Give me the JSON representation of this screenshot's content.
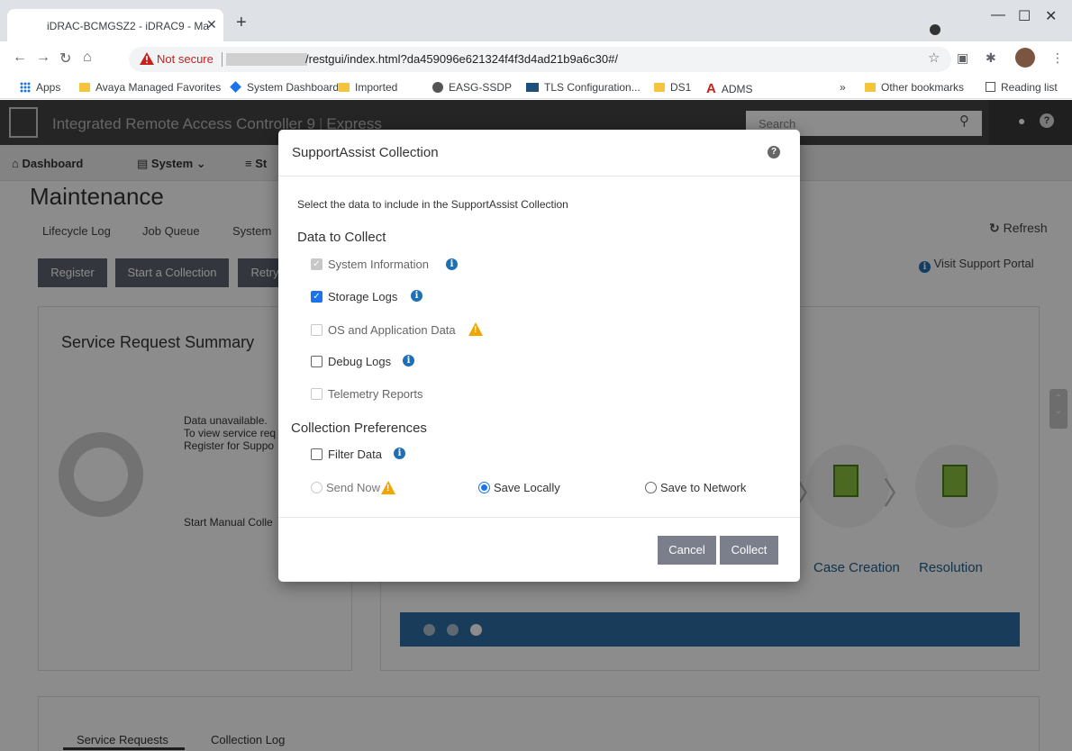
{
  "browser": {
    "tab_title": "iDRAC-BCMGSZ2 - iDRAC9 - Ma",
    "new_tab_label": "+",
    "not_secure": "Not secure",
    "url": "/restgui/index.html?da459096e621324f4f3d4ad21b9a6c30#/",
    "bookmarks": [
      "Apps",
      "Avaya Managed Favorites",
      "System Dashboard...",
      "Imported",
      "EASG-SSDP",
      "TLS Configuration...",
      "DS1",
      "ADMS"
    ],
    "overflow_label": "»",
    "other_bookmarks": "Other bookmarks",
    "reading_list": "Reading list"
  },
  "idrac": {
    "header_title": "Integrated Remote Access Controller 9",
    "header_edition": "Express",
    "search_placeholder": "Search",
    "nav": [
      "Dashboard",
      "System",
      "St"
    ],
    "page_title": "Maintenance",
    "subtabs": [
      "Lifecycle Log",
      "Job Queue",
      "System"
    ],
    "refresh": "Refresh",
    "buttons": [
      "Register",
      "Start a Collection",
      "Retry"
    ],
    "support_portal": "Visit Support Portal",
    "summary_title": "Service Request Summary",
    "data_unavailable": "Data unavailable.",
    "view_service": "To view service req",
    "register_support": "Register for Suppo",
    "start_manual": "Start Manual Colle",
    "process_labels": [
      "Case Creation",
      "Resolution"
    ],
    "bottom_tabs": [
      "Service Requests",
      "Collection Log"
    ]
  },
  "modal": {
    "title": "SupportAssist Collection",
    "intro": "Select the data to include in the SupportAssist Collection",
    "data_heading": "Data to Collect",
    "items": [
      {
        "label": "System Information",
        "state": "disabled-checked",
        "icon": "info"
      },
      {
        "label": "Storage Logs",
        "state": "checked",
        "icon": "info"
      },
      {
        "label": "OS and Application Data",
        "state": "disabled",
        "icon": "warning"
      },
      {
        "label": "Debug Logs",
        "state": "unchecked",
        "icon": "info"
      },
      {
        "label": "Telemetry Reports",
        "state": "disabled",
        "icon": ""
      }
    ],
    "pref_heading": "Collection Preferences",
    "filter_data": "Filter Data",
    "send_now": "Send Now",
    "save_locally": "Save Locally",
    "save_network": "Save to Network",
    "cancel": "Cancel",
    "collect": "Collect"
  },
  "colors": {
    "accent_blue": "#1a73e8",
    "info_blue": "#1f6fb5",
    "warning": "#f0a500",
    "button_grey": "#7b7f8c"
  }
}
